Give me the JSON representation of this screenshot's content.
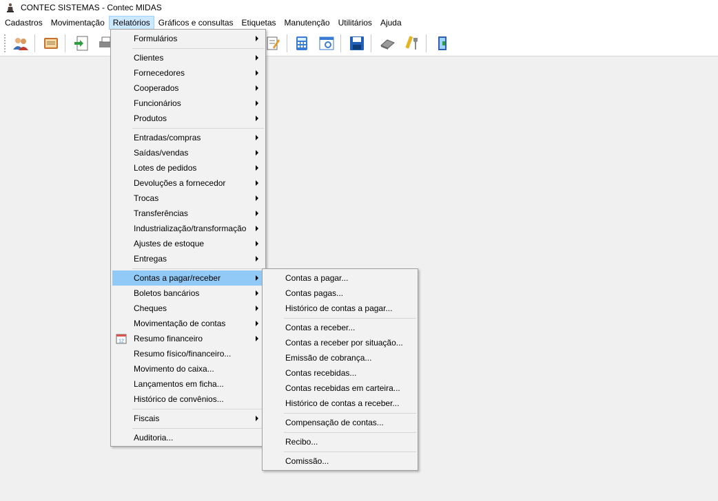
{
  "window": {
    "title": "CONTEC SISTEMAS - Contec MIDAS",
    "icon": "app-figure-icon"
  },
  "menubar": {
    "items": [
      "Cadastros",
      "Movimentação",
      "Relatórios",
      "Gráficos e consultas",
      "Etiquetas",
      "Manutenção",
      "Utilitários",
      "Ajuda"
    ],
    "active": "Relatórios"
  },
  "toolbar": {
    "icons": [
      "users-icon",
      "address-book-icon",
      "import-document-icon",
      "printer-icon",
      "edit-document-icon",
      "calculator-icon",
      "browser-window-icon",
      "save-disk-icon",
      "eraser-icon",
      "tools-icon",
      "exit-door-icon"
    ]
  },
  "relatorios_menu": {
    "items": {
      "formularios": "Formulários",
      "clientes": "Clientes",
      "fornecedores": "Fornecedores",
      "cooperados": "Cooperados",
      "funcionarios": "Funcionários",
      "produtos": "Produtos",
      "entradas": "Entradas/compras",
      "saidas": "Saídas/vendas",
      "lotes": "Lotes de pedidos",
      "devolucoes": "Devoluções a fornecedor",
      "trocas": "Trocas",
      "transferencias": "Transferências",
      "industrializacao": "Industrialização/transformação",
      "ajustes": "Ajustes de estoque",
      "entregas": "Entregas",
      "contas": "Contas a pagar/receber",
      "boletos": "Boletos bancários",
      "cheques": "Cheques",
      "movimentacao_contas": "Movimentação de contas",
      "resumo_financeiro": "Resumo financeiro",
      "resumo_fisico": "Resumo físico/financeiro...",
      "movimento_caixa": "Movimento do caixa...",
      "lancamentos": "Lançamentos em ficha...",
      "historico_convenios": "Histórico de convênios...",
      "fiscais": "Fiscais",
      "auditoria": "Auditoria..."
    },
    "highlighted": "Contas a pagar/receber",
    "resumo_icon_text": "12"
  },
  "contas_submenu": {
    "items": {
      "contas_pagar": "Contas a pagar...",
      "contas_pagas": "Contas pagas...",
      "historico_pagar": "Histórico de contas a pagar...",
      "contas_receber": "Contas a receber...",
      "receber_situacao": "Contas a receber por situação...",
      "emissao_cobranca": "Emissão de cobrança...",
      "contas_recebidas": "Contas recebidas...",
      "recebidas_carteira": "Contas recebidas em carteira...",
      "historico_receber": "Histórico de contas a receber...",
      "compensacao": "Compensação de contas...",
      "recibo": "Recibo...",
      "comissao": "Comissão..."
    }
  },
  "colors": {
    "highlight": "#91c9f7",
    "menubar_active": "#cce8ff",
    "workspace": "#f0f0f0"
  }
}
